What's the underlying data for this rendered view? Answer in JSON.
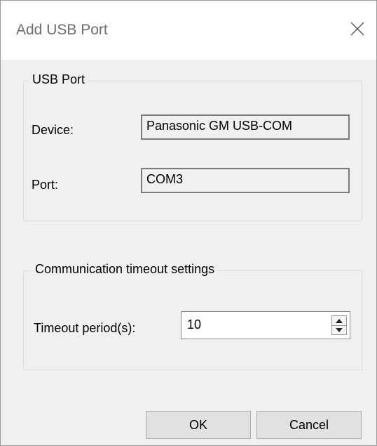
{
  "window": {
    "title": "Add USB Port",
    "close_icon": "close-icon"
  },
  "usb_port_group": {
    "legend": "USB Port",
    "device_label": "Device:",
    "device_value": "Panasonic GM USB-COM",
    "port_label": "Port:",
    "port_value": "COM3"
  },
  "timeout_group": {
    "legend": "Communication timeout settings",
    "timeout_label": "Timeout period(s):",
    "timeout_value": "10"
  },
  "buttons": {
    "ok_label": "OK",
    "cancel_label": "Cancel"
  },
  "colors": {
    "dialog_background": "#f0f0f0",
    "titlebar_background": "#ffffff",
    "title_text": "#6d6d6d"
  }
}
